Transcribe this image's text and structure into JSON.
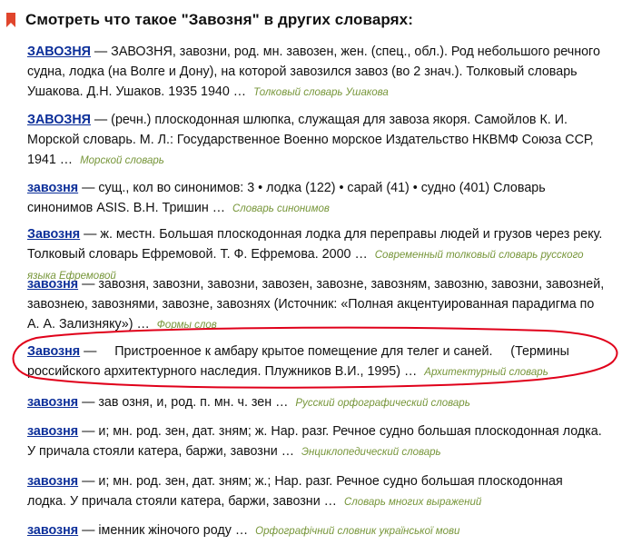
{
  "header": {
    "title": "Смотреть что такое \"Завозня\" в других словарях:",
    "icon": "bookmark-icon",
    "accent_color": "#e0452c"
  },
  "colors": {
    "link": "#0b2e99",
    "source": "#77963a",
    "highlight_circle": "#e0001a"
  },
  "entries": [
    {
      "term": "ЗАВОЗНЯ",
      "text": " — ЗАВОЗНЯ, завозни, род. мн. завозен, жен. (спец., обл.). Род небольшого речного судна, лодка (на Волге и Дону), на которой завозился завоз (во 2 знач.). Толковый словарь Ушакова. Д.Н. Ушаков. 1935 1940 …",
      "source": "Толковый словарь Ушакова"
    },
    {
      "term": "ЗАВОЗНЯ",
      "text": " — (речн.) плоскодонная шлюпка, служащая для завоза якоря. Самойлов К. И. Морской словарь. М. Л.: Государственное Военно морское Издательство НКВМФ Союза ССР, 1941 …",
      "source": "Морской словарь"
    },
    {
      "term": "завозня",
      "text": " — сущ., кол во синонимов: 3 • лодка (122) • сарай (41) • судно (401) Словарь синонимов ASIS. В.Н. Тришин …",
      "source": "Словарь синонимов"
    },
    {
      "term": "Завозня",
      "text": " — ж. местн. Большая плоскодонная лодка для переправы людей и грузов через реку. Толковый словарь Ефремовой. Т. Ф. Ефремова. 2000 …",
      "source": "Современный толковый словарь русского языка Ефремовой"
    },
    {
      "term": "завозня",
      "text": " — завозня, завозни, завозни, завозен, завозне, завозням, завозню, завозни, завозней, завознею, завознями, завозне, завознях (Источник: «Полная акцентуированная парадигма по А. А. Зализняку») …",
      "source": "Формы слов"
    },
    {
      "term": "Завозня",
      "text": " —     Пристроенное к амбару крытое помещение для телег и саней.     (Термины российского архитектурного наследия. Плужников В.И., 1995) …",
      "source": "Архитектурный словарь"
    },
    {
      "term": "завозня",
      "text": " — зав озня, и, род. п. мн. ч. зен …",
      "source": "Русский орфографический словарь"
    },
    {
      "term": "завозня",
      "text": " — и; мн. род. зен, дат. зням; ж. Нар. разг. Речное судно большая плоскодонная лодка. У причала стояли катера, баржи, завозни …",
      "source": "Энциклопедический словарь"
    },
    {
      "term": "завозня",
      "text": " — и; мн. род. зен, дат. зням; ж.; Нар. разг. Речное судно большая плоскодонная лодка. У причала стояли катера, баржи, завозни …",
      "source": "Словарь многих выражений"
    },
    {
      "term": "завозня",
      "text": " — іменник жіночого роду …",
      "source": "Орфографічний словник української мови"
    }
  ]
}
